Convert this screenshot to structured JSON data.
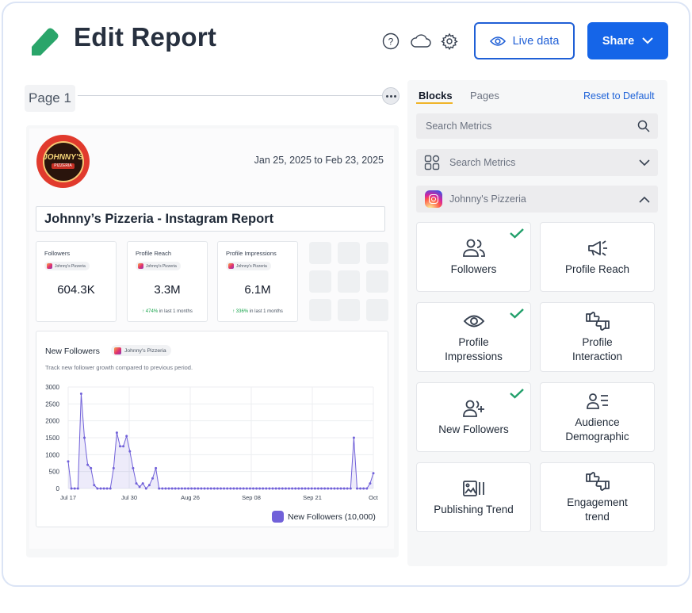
{
  "header": {
    "title": "Edit Report",
    "live_label": "Live data",
    "share_label": "Share"
  },
  "page": {
    "label": "Page 1"
  },
  "report": {
    "logo_text": "JOHNNY'S",
    "logo_subtext": "PIZZERIA",
    "date_range": "Jan 25, 2025 to Feb 23, 2025",
    "title": "Johnny’s Pizzeria - Instagram Report",
    "stats": [
      {
        "label": "Followers",
        "account": "Johnny's Pizzeria",
        "value": "604.3K",
        "delta_pct": "",
        "delta_text": ""
      },
      {
        "label": "Profile Reach",
        "account": "Johnny's Pizzeria",
        "value": "3.3M",
        "delta_pct": "↑ 474%",
        "delta_text": " in last 1 months"
      },
      {
        "label": "Profile Impressions",
        "account": "Johnny's Pizzeria",
        "value": "6.1M",
        "delta_pct": "↑ 336%",
        "delta_text": " in last 1 months"
      }
    ],
    "chart_card": {
      "title": "New Followers",
      "account": "Johnny's Pizzeria",
      "subtitle": "Track new follower growth compared to previous period.",
      "legend": "New Followers (10,000)"
    }
  },
  "chart_data": {
    "type": "area",
    "title": "New Followers",
    "xlabel": "",
    "ylabel": "",
    "ylim": [
      0,
      3000
    ],
    "yticks": [
      0,
      500,
      1000,
      1500,
      2000,
      2500,
      3000
    ],
    "xtick_labels": [
      "Jul 17",
      "Jul 30",
      "Aug 26",
      "Sep 08",
      "Sep 21",
      "Oct"
    ],
    "grid": true,
    "series": [
      {
        "name": "New Followers (10,000)",
        "color": "#7161d9",
        "values": [
          800,
          0,
          0,
          0,
          2800,
          1500,
          700,
          600,
          100,
          0,
          0,
          0,
          0,
          0,
          600,
          1650,
          1250,
          1250,
          1550,
          1100,
          600,
          150,
          50,
          150,
          0,
          100,
          300,
          600,
          0,
          0,
          0,
          0,
          0,
          0,
          0,
          0,
          0,
          0,
          0,
          0,
          0,
          0,
          0,
          0,
          0,
          0,
          0,
          0,
          0,
          0,
          0,
          0,
          0,
          0,
          0,
          0,
          0,
          0,
          0,
          0,
          0,
          0,
          0,
          0,
          0,
          0,
          0,
          0,
          0,
          0,
          0,
          0,
          0,
          0,
          0,
          0,
          0,
          0,
          0,
          0,
          0,
          0,
          0,
          0,
          0,
          0,
          0,
          0,
          1500,
          0,
          0,
          0,
          0,
          150,
          450
        ]
      }
    ]
  },
  "panel": {
    "tab_blocks": "Blocks",
    "tab_pages": "Pages",
    "reset_label": "Reset to Default",
    "search_placeholder": "Search Metrics",
    "category_placeholder": "Search Metrics",
    "account_name": "Johnny's Pizzeria",
    "blocks": [
      {
        "label": "Followers",
        "icon": "users-icon",
        "checked": true
      },
      {
        "label": "Profile Reach",
        "icon": "megaphone-icon",
        "checked": false
      },
      {
        "label": "Profile\nImpressions",
        "icon": "eye-icon",
        "checked": true
      },
      {
        "label": "Profile\nInteraction",
        "icon": "thumbs-icon",
        "checked": false
      },
      {
        "label": "New Followers",
        "icon": "user-plus-icon",
        "checked": true
      },
      {
        "label": "Audience\nDemographic",
        "icon": "audience-icon",
        "checked": false
      },
      {
        "label": "Publishing Trend",
        "icon": "gallery-icon",
        "checked": false
      },
      {
        "label": "Engagement\ntrend",
        "icon": "thumbs-icon",
        "checked": false
      }
    ]
  },
  "colors": {
    "accent": "#1565e8",
    "pencil": "#2aa56a",
    "check": "#22a06b",
    "series": "#7161d9"
  }
}
